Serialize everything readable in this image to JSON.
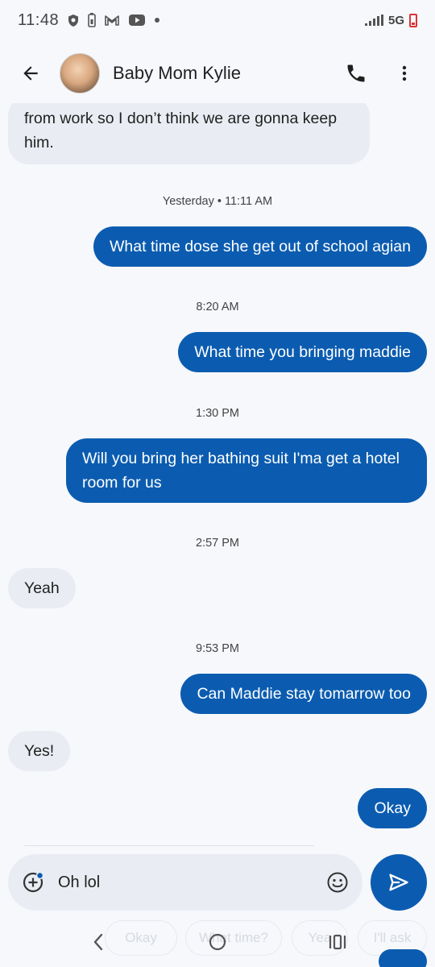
{
  "status_bar": {
    "time": "11:48",
    "network": "5G",
    "icons": [
      "shield-icon",
      "battery-saver-icon",
      "gmail-icon",
      "youtube-icon",
      "notification-dot-icon",
      "signal-icon",
      "battery-icon"
    ]
  },
  "header": {
    "contact_name": "Baby Mom Kylie",
    "back_icon": "arrow-back-icon",
    "call_icon": "phone-icon",
    "menu_icon": "more-vert-icon"
  },
  "messages": [
    {
      "type": "in",
      "text": "from work so I don’t think we are gonna keep him."
    },
    {
      "type": "stamp",
      "text": "Yesterday • 11:11 AM"
    },
    {
      "type": "out",
      "text": "What time dose she get out of school agian"
    },
    {
      "type": "stamp",
      "text": "8:20 AM"
    },
    {
      "type": "out",
      "text": "What time you bringing maddie"
    },
    {
      "type": "stamp",
      "text": "1:30 PM"
    },
    {
      "type": "out",
      "text": "Will you bring her bathing suit I'ma get a hotel room for us"
    },
    {
      "type": "stamp",
      "text": "2:57 PM"
    },
    {
      "type": "in",
      "text": "Yeah"
    },
    {
      "type": "stamp",
      "text": "9:53 PM"
    },
    {
      "type": "out",
      "text": "Can Maddie stay tomarrow too"
    },
    {
      "type": "in",
      "text": "Yes!"
    },
    {
      "type": "out",
      "text": "Okay"
    }
  ],
  "composer": {
    "text": "Oh lol",
    "add_icon": "add-attachment-icon",
    "emoji_icon": "emoji-icon",
    "send_icon": "send-icon"
  },
  "suggestions": [
    "Okay",
    "What time?",
    "Yea",
    "I'll ask"
  ],
  "colors": {
    "outgoing_bubble": "#0b5cb0",
    "incoming_bubble": "#e9edf3",
    "background": "#f6f8fc"
  }
}
